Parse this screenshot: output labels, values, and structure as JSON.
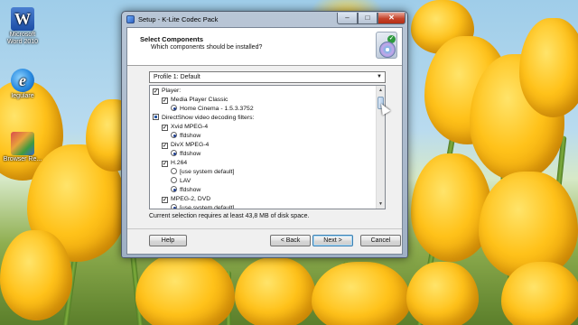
{
  "desktop": {
    "icons": [
      {
        "label": "Microsoft Word 2010",
        "glyph": "W"
      },
      {
        "label": "Iegulare",
        "glyph": "e"
      },
      {
        "label": "Browser Re...",
        "glyph": ""
      }
    ]
  },
  "window": {
    "title": "Setup - K-Lite Codec Pack",
    "controls": {
      "minimize": "–",
      "maximize": "□",
      "close": "✕"
    }
  },
  "header": {
    "title": "Select Components",
    "subtitle": "Which components should be installed?"
  },
  "profile": {
    "selected": "Profile 1: Default",
    "arrow": "▼"
  },
  "tree": {
    "rows": [
      {
        "kind": "check",
        "state": "checked",
        "indent": 0,
        "label": "Player:"
      },
      {
        "kind": "check",
        "state": "checked",
        "indent": 1,
        "label": "Media Player Classic"
      },
      {
        "kind": "radio",
        "state": "on",
        "indent": 2,
        "label": "Home Cinema - 1.5.3.3752"
      },
      {
        "kind": "check",
        "state": "partial",
        "indent": 0,
        "label": "DirectShow video decoding filters:"
      },
      {
        "kind": "check",
        "state": "checked",
        "indent": 1,
        "label": "Xvid MPEG-4"
      },
      {
        "kind": "radio",
        "state": "on",
        "indent": 2,
        "label": "ffdshow"
      },
      {
        "kind": "check",
        "state": "checked",
        "indent": 1,
        "label": "DivX MPEG-4"
      },
      {
        "kind": "radio",
        "state": "on",
        "indent": 2,
        "label": "ffdshow"
      },
      {
        "kind": "check",
        "state": "checked",
        "indent": 1,
        "label": "H.264"
      },
      {
        "kind": "radio",
        "state": "off",
        "indent": 2,
        "label": "[use system default]"
      },
      {
        "kind": "radio",
        "state": "off",
        "indent": 2,
        "label": "LAV"
      },
      {
        "kind": "radio",
        "state": "on",
        "indent": 2,
        "label": "ffdshow"
      },
      {
        "kind": "check",
        "state": "checked",
        "indent": 1,
        "label": "MPEG-2, DVD"
      },
      {
        "kind": "radio",
        "state": "on",
        "indent": 2,
        "label": "[use system default]"
      }
    ]
  },
  "disk_info": "Current selection requires at least 43,8 MB of disk space.",
  "buttons": {
    "help": "Help",
    "back": "< Back",
    "next": "Next >",
    "cancel": "Cancel"
  }
}
